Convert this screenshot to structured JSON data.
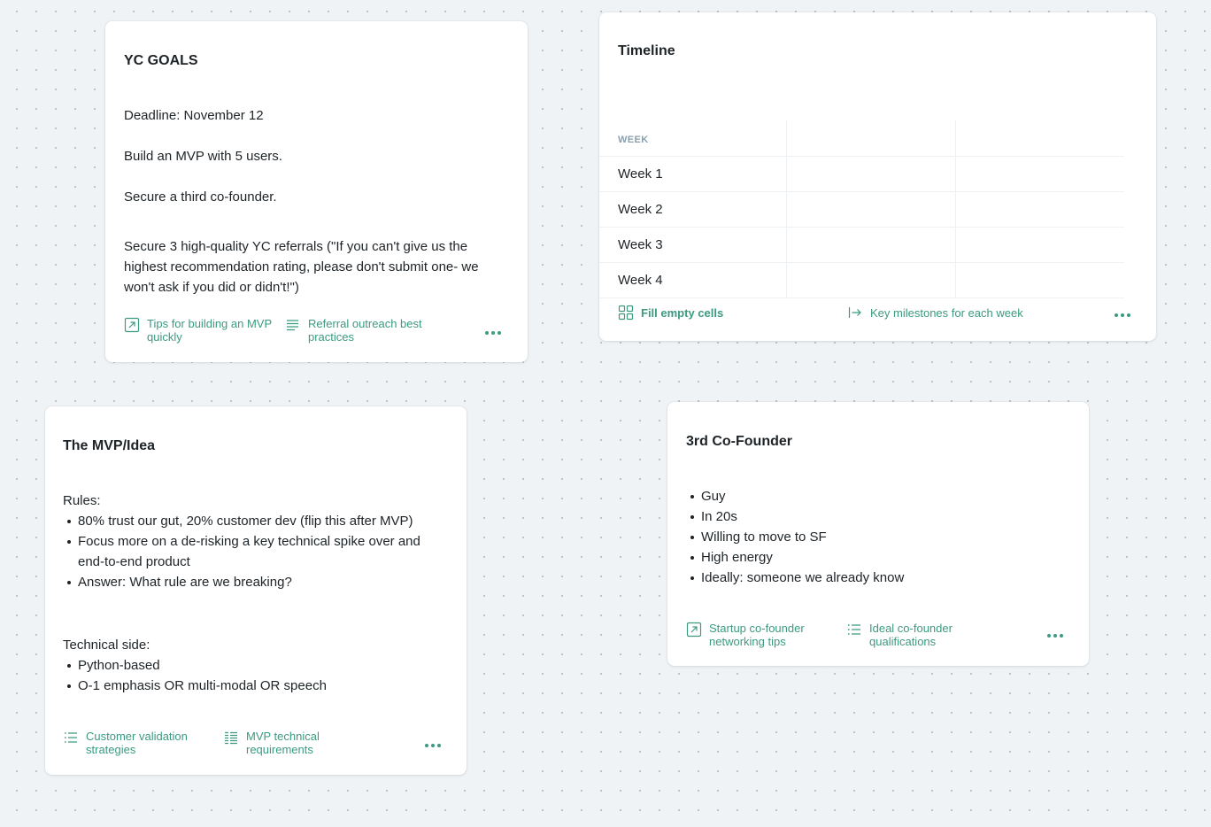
{
  "colors": {
    "accent": "#3b9a80",
    "canvas": "#eff3f5",
    "card": "#ffffff",
    "header_muted": "#8aa1ad"
  },
  "yc_goals": {
    "title": "YC GOALS",
    "lines": [
      "Deadline: November 12",
      "Build an MVP with 5 users.",
      "Secure a third co-founder.",
      "Secure 3 high-quality YC referrals (\"If you can't give us the highest recommendation rating, please don't submit one- we won't ask if you did or didn't!\")"
    ],
    "actions": [
      {
        "icon": "arrow-box-icon",
        "label": "Tips for building an MVP quickly"
      },
      {
        "icon": "text-lines-icon",
        "label": "Referral outreach best practices"
      }
    ],
    "more_icon": "more-horizontal-icon"
  },
  "timeline": {
    "title": "Timeline",
    "column_header": "WEEK",
    "rows": [
      "Week 1",
      "Week 2",
      "Week 3",
      "Week 4"
    ],
    "actions": [
      {
        "icon": "grid-icon",
        "label": "Fill empty cells"
      },
      {
        "icon": "arrow-right-bar-icon",
        "label": "Key milestones for each week"
      }
    ],
    "more_icon": "more-horizontal-icon"
  },
  "mvp_idea": {
    "title": "The MVP/Idea",
    "rules_label": "Rules:",
    "rules": [
      "80% trust our gut,  20% customer dev (flip this after MVP)",
      "Focus more on a de-risking a key technical spike over and end-to-end product",
      "Answer: What rule are we breaking?"
    ],
    "technical_label": "Technical side:",
    "technical": [
      "Python-based",
      "O-1 emphasis OR multi-modal OR speech"
    ],
    "actions": [
      {
        "icon": "list-icon",
        "label": "Customer validation strategies"
      },
      {
        "icon": "table-list-icon",
        "label": "MVP technical requirements"
      }
    ],
    "more_icon": "more-horizontal-icon"
  },
  "cofounder": {
    "title": "3rd Co-Founder",
    "items": [
      "Guy",
      "In 20s",
      "Willing to move to SF",
      "High energy",
      "Ideally: someone we already know"
    ],
    "actions": [
      {
        "icon": "arrow-box-icon",
        "label": "Startup co-founder networking tips"
      },
      {
        "icon": "list-icon",
        "label": "Ideal co-founder qualifications"
      }
    ],
    "more_icon": "more-horizontal-icon"
  }
}
